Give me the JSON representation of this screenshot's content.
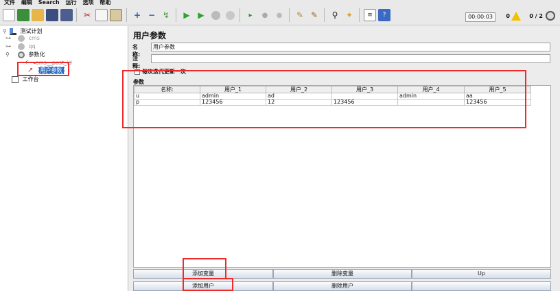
{
  "menu": [
    "文件",
    "编辑",
    "Search",
    "运行",
    "选项",
    "帮助"
  ],
  "toolbar": {
    "icons": [
      "new-icon",
      "templates-icon",
      "open-icon",
      "save-icon",
      "save-as-icon",
      "cut-icon",
      "copy-icon",
      "paste-icon",
      "expand-icon",
      "collapse-icon",
      "toggle-icon",
      "start-icon",
      "start-no-pauses-icon",
      "stop-icon",
      "shutdown-icon",
      "remote-start-icon",
      "remote-stop-icon",
      "remote-shutdown-icon",
      "clear-icon",
      "clear-all-icon",
      "search-icon",
      "reset-search-icon",
      "function-helper-icon",
      "help-icon"
    ],
    "timer": "00:00:03",
    "error_count": "0",
    "thread_count": "0 / 2"
  },
  "tree": {
    "test_plan": "测试计划",
    "cms": "cms",
    "qq": "qq",
    "params": "参数化",
    "sampler": "cms__post_id",
    "user_params": "用户参数",
    "workbench": "工作台"
  },
  "panel": {
    "title": "用户参数",
    "name_label": "名称:",
    "name_value": "用户参数",
    "comment_label": "注释:",
    "comment_value": "",
    "update_each_iteration": "每次迭代更新一次",
    "params_label": "参数",
    "columns": [
      "名称:",
      "用户_1",
      "用户_2",
      "用户_3",
      "用户_4",
      "用户_5"
    ],
    "rows": [
      [
        "u",
        "admin",
        "ad",
        "",
        "admin",
        "aa"
      ],
      [
        "p",
        "123456",
        "12",
        "123456",
        "",
        "123456"
      ]
    ],
    "buttons": {
      "add_var": "添加变量",
      "del_var": "删除变量",
      "up": "Up",
      "add_user": "添加用户",
      "del_user": "删除用户"
    }
  },
  "colors": {
    "highlight_red": "#ee2a2a",
    "selection_blue": "#2d6fc4",
    "run_green": "#2aa52a"
  }
}
